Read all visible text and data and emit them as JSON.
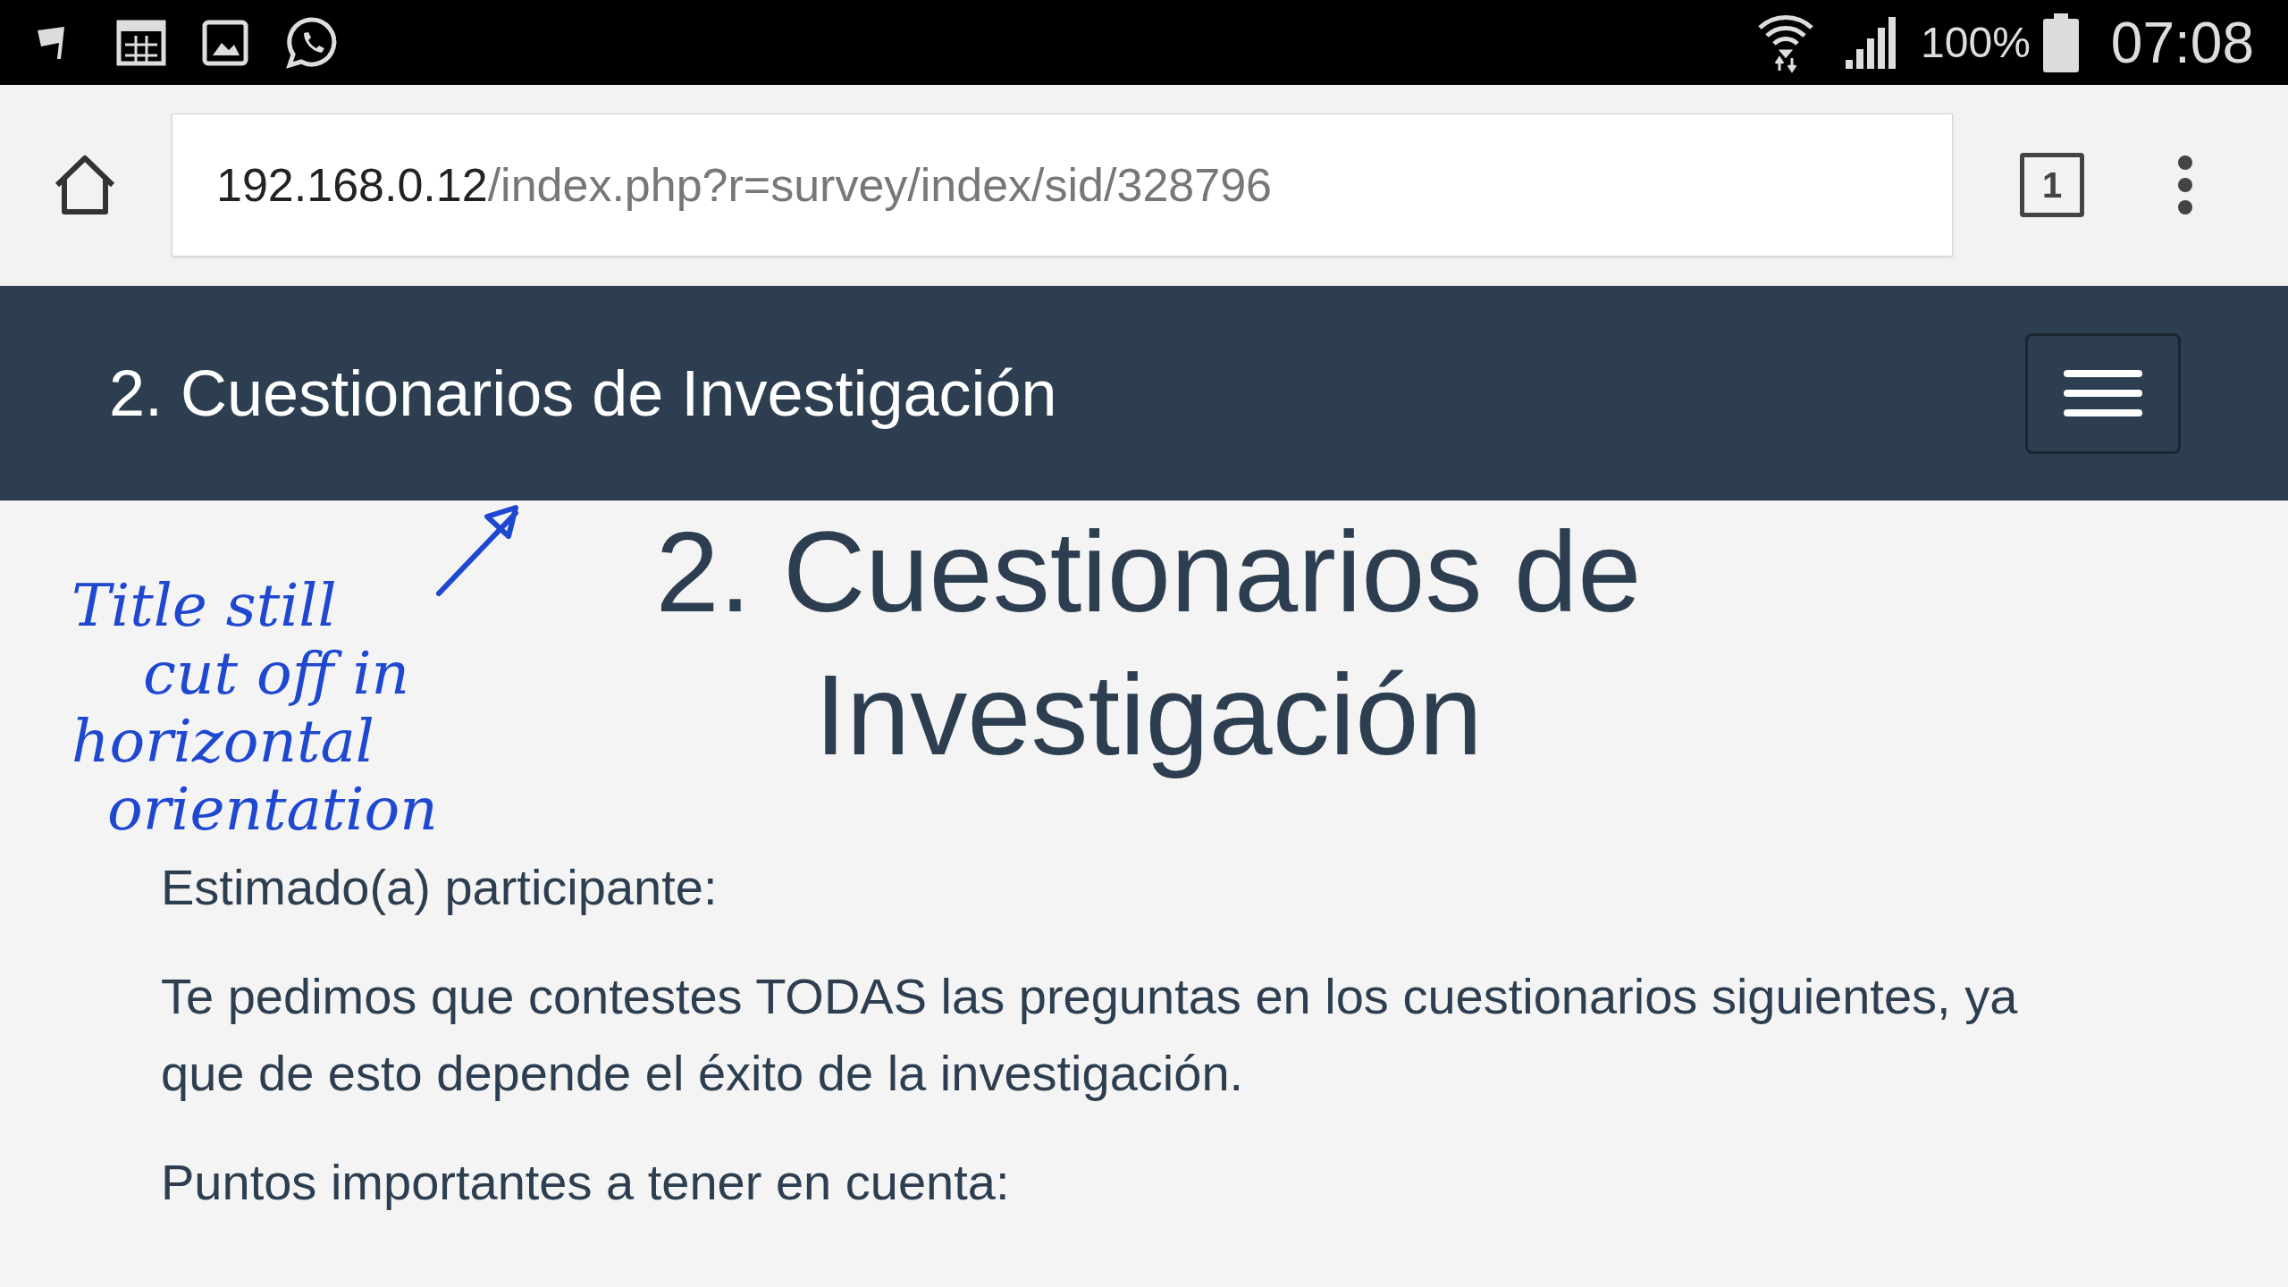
{
  "status_bar": {
    "battery": "100%",
    "time": "07:08"
  },
  "browser": {
    "url_host": "192.168.0.12",
    "url_path": "/index.php?r=survey/index/sid/328796",
    "tab_count": "1"
  },
  "navbar": {
    "title": "2. Cuestionarios de Investigación"
  },
  "page": {
    "heading_lines": [
      "2. Cuestionarios de",
      "Investigación"
    ],
    "paragraphs": [
      "Estimado(a) participante:",
      "Te pedimos que contestes TODAS las preguntas en los cuestionarios siguientes, ya que de esto depende el éxito de la investigación.",
      "Puntos importantes a tener en cuenta:"
    ]
  },
  "annotation": {
    "lines": [
      "Title still",
      "cut off in",
      "horizontal",
      "orientation"
    ]
  }
}
